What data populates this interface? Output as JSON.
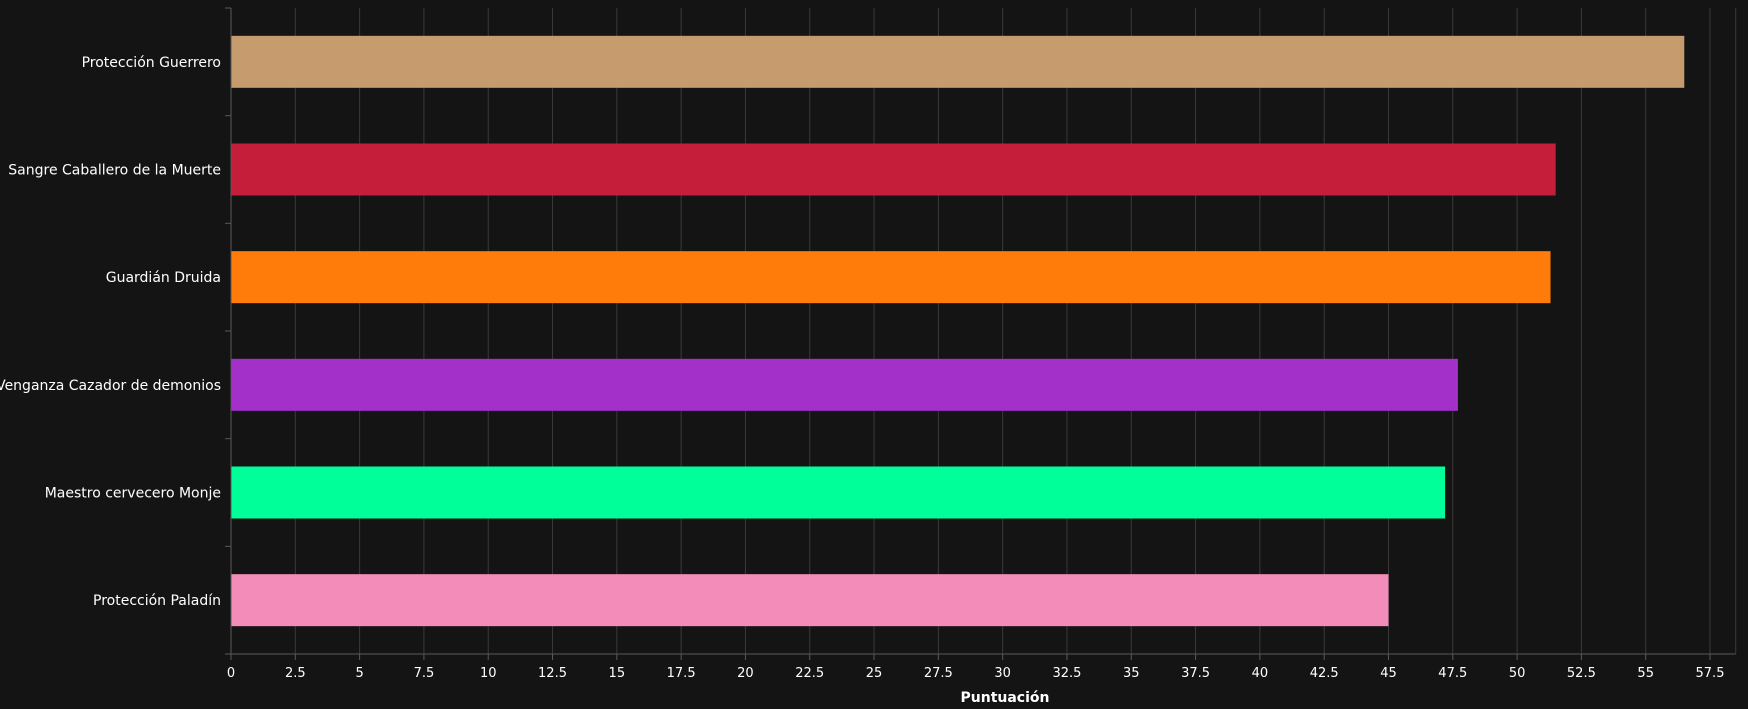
{
  "chart_data": {
    "type": "bar",
    "orientation": "horizontal",
    "categories": [
      "Protección Guerrero",
      "Sangre Caballero de la Muerte",
      "Guardián Druida",
      "Venganza Cazador de demonios",
      "Maestro cervecero Monje",
      "Protección Paladín"
    ],
    "values": [
      56.5,
      51.5,
      51.3,
      47.7,
      47.2,
      45.0
    ],
    "colors": [
      "#c69b6d",
      "#c41e3a",
      "#ff7c0a",
      "#a330c9",
      "#00ff98",
      "#f48cba"
    ],
    "xlabel": "Puntuación",
    "ylabel": "",
    "xlim": [
      0,
      58.5
    ],
    "xticks": [
      "0",
      "2.5",
      "5",
      "7.5",
      "10",
      "12.5",
      "15",
      "17.5",
      "20",
      "22.5",
      "25",
      "27.5",
      "30",
      "32.5",
      "35",
      "37.5",
      "40",
      "42.5",
      "45",
      "47.5",
      "50",
      "52.5",
      "55",
      "57.5"
    ],
    "grid": true
  }
}
